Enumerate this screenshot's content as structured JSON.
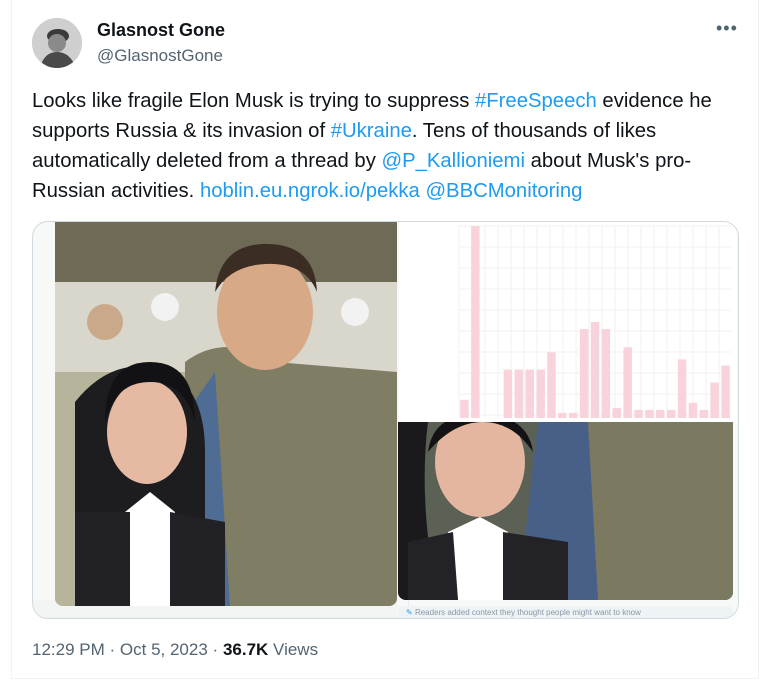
{
  "author": {
    "name": "Glasnost Gone",
    "handle": "@GlasnostGone"
  },
  "tweet": {
    "segments": [
      {
        "text": "Looks like fragile Elon Musk is trying to suppress ",
        "link": false
      },
      {
        "text": "#FreeSpeech",
        "link": true
      },
      {
        "text": " evidence he supports Russia & its invasion of ",
        "link": false
      },
      {
        "text": "#Ukraine",
        "link": true
      },
      {
        "text": ". Tens of thousands of likes automatically deleted from a thread by ",
        "link": false
      },
      {
        "text": "@P_Kallioniemi",
        "link": true
      },
      {
        "text": " about Musk's pro-Russian activities. ",
        "link": false
      },
      {
        "text": "hoblin.eu.ngrok.io/pekka",
        "link": true
      },
      {
        "text": " ",
        "link": false
      },
      {
        "text": "@BBCMonitoring",
        "link": true
      }
    ]
  },
  "media": {
    "note_text": "Readers added context they thought people might want to know"
  },
  "chart_data": {
    "type": "bar",
    "color": "#f9d3dc",
    "values": [
      18,
      190,
      0,
      0,
      48,
      48,
      48,
      48,
      65,
      5,
      5,
      88,
      95,
      88,
      10,
      70,
      8,
      8,
      8,
      8,
      58,
      15,
      8,
      35,
      52
    ],
    "ylim": [
      0,
      190
    ]
  },
  "footer": {
    "time": "12:29 PM",
    "separator": "·",
    "date": "Oct 5, 2023",
    "views_count": "36.7K",
    "views_label": "Views"
  }
}
